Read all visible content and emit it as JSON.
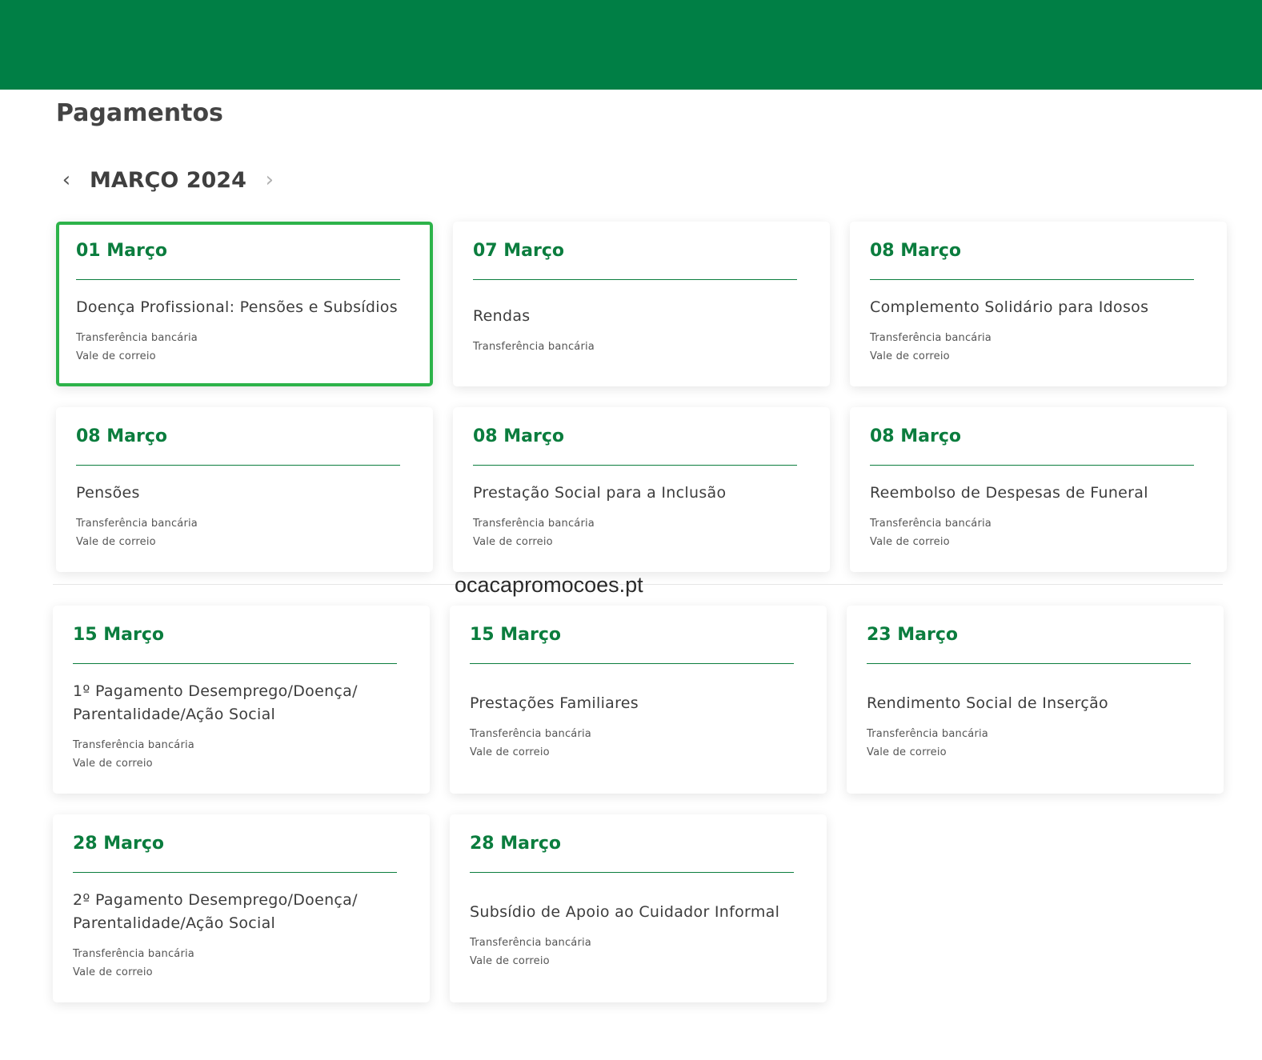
{
  "header": {
    "title": "Pagamentos"
  },
  "calendar": {
    "month_label": "MARÇO 2024",
    "prev_icon": "‹",
    "next_icon": "›"
  },
  "watermark": "ocacapromocoes.pt",
  "colors": {
    "brand_green": "#007f45",
    "date_green": "#0b7d3e",
    "selected_outline": "#2db34a"
  },
  "payments": [
    {
      "date": "01 Março",
      "name": "Doença Profissional: Pensões e Subsídios",
      "methods": [
        "Transferência bancária",
        "Vale de correio"
      ],
      "selected": true
    },
    {
      "date": "07 Março",
      "name": "Rendas",
      "methods": [
        "Transferência bancária"
      ]
    },
    {
      "date": "08 Março",
      "name": "Complemento Solidário para Idosos",
      "methods": [
        "Transferência bancária",
        "Vale de correio"
      ]
    },
    {
      "date": "08 Março",
      "name": "Pensões",
      "methods": [
        "Transferência bancária",
        "Vale de correio"
      ]
    },
    {
      "date": "08 Março",
      "name": "Prestação Social para a Inclusão",
      "methods": [
        "Transferência bancária",
        "Vale de correio"
      ]
    },
    {
      "date": "08 Março",
      "name": "Reembolso de Despesas de Funeral",
      "methods": [
        "Transferência bancária",
        "Vale de correio"
      ]
    },
    {
      "date": "15 Março",
      "name": "1º Pagamento Desemprego/Doença/ Parentalidade/Ação Social",
      "methods": [
        "Transferência bancária",
        "Vale de correio"
      ]
    },
    {
      "date": "15 Março",
      "name": "Prestações Familiares",
      "methods": [
        "Transferência bancária",
        "Vale de correio"
      ]
    },
    {
      "date": "23 Março",
      "name": "Rendimento Social de Inserção",
      "methods": [
        "Transferência bancária",
        "Vale de correio"
      ]
    },
    {
      "date": "28 Março",
      "name": "2º Pagamento Desemprego/Doença/ Parentalidade/Ação Social",
      "methods": [
        "Transferência bancária",
        "Vale de correio"
      ]
    },
    {
      "date": "28 Março",
      "name": "Subsídio de Apoio ao Cuidador Informal",
      "methods": [
        "Transferência bancária",
        "Vale de correio"
      ]
    }
  ]
}
